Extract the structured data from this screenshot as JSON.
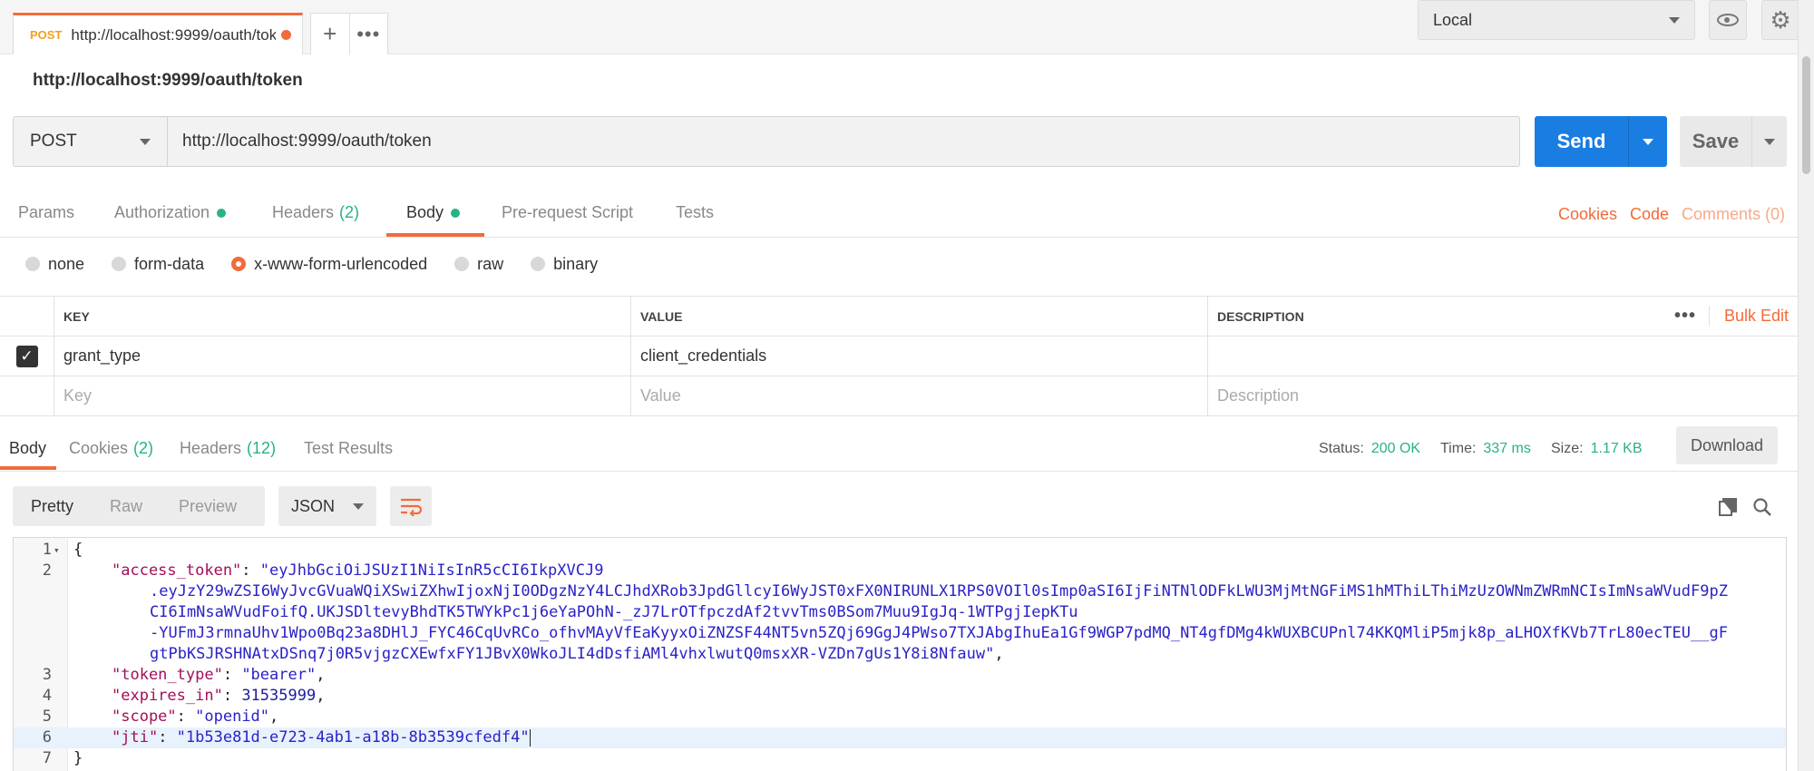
{
  "request_tab": {
    "method": "POST",
    "title": "http://localhost:9999/oauth/tok"
  },
  "tab_actions": {
    "new_tab": "+",
    "more": "•••"
  },
  "environment": {
    "selected": "Local"
  },
  "request": {
    "name": "http://localhost:9999/oauth/token",
    "method": "POST",
    "url": "http://localhost:9999/oauth/token",
    "send_label": "Send",
    "save_label": "Save"
  },
  "request_tabs": {
    "params": "Params",
    "authorization": "Authorization",
    "headers": "Headers",
    "headers_count": "(2)",
    "body": "Body",
    "prerequest": "Pre-request Script",
    "tests": "Tests",
    "cookies": "Cookies",
    "code": "Code",
    "comments": "Comments (0)"
  },
  "body_modes": {
    "none": "none",
    "form_data": "form-data",
    "urlencoded": "x-www-form-urlencoded",
    "raw": "raw",
    "binary": "binary",
    "selected": "x-www-form-urlencoded"
  },
  "params_table": {
    "headers": {
      "key": "KEY",
      "value": "VALUE",
      "description": "DESCRIPTION",
      "more": "•••",
      "bulk_edit": "Bulk Edit"
    },
    "rows": [
      {
        "checked": true,
        "key": "grant_type",
        "value": "client_credentials",
        "description": ""
      }
    ],
    "placeholders": {
      "key": "Key",
      "value": "Value",
      "description": "Description"
    }
  },
  "response": {
    "tabs": {
      "body": "Body",
      "cookies": "Cookies",
      "cookies_count": "(2)",
      "headers": "Headers",
      "headers_count": "(12)",
      "test_results": "Test Results"
    },
    "status_label": "Status:",
    "status_value": "200 OK",
    "time_label": "Time:",
    "time_value": "337 ms",
    "size_label": "Size:",
    "size_value": "1.17 KB",
    "download_label": "Download",
    "views": {
      "pretty": "Pretty",
      "raw": "Raw",
      "preview": "Preview"
    },
    "format": "JSON"
  },
  "code_lines": {
    "l1_num": "1",
    "l2_num": "2",
    "l3_num": "3",
    "l4_num": "4",
    "l5_num": "5",
    "l6_num": "6",
    "l7_num": "7",
    "open_brace": "{",
    "close_brace": "}",
    "access_token_key": "\"access_token\"",
    "access_token_p1": "\"eyJhbGciOiJSUzI1NiIsInR5cCI6IkpXVCJ9",
    "access_token_p2": ".eyJzY29wZSI6WyJvcGVuaWQiXSwiZXhwIjoxNjI0ODgzNzY4LCJhdXRob3JpdGllcyI6WyJST0xFX0NIRUNLX1RPS0VOIl0sImp0aSI6IjFiNTNlODFkLWU3MjMtNGFiMS1hMThiLThiMzUzOWNmZWRmNCIsImNsaWVudF9pZ",
    "access_token_p3": "CI6ImNsaWVudFoifQ.UKJSDltevyBhdTK5TWYkPc1j6eYaPOhN-_zJ7LrOTfpczdAf2tvvTms0BSom7Muu9IgJq-1WTPgjIepKTu",
    "access_token_p4": "-YUFmJ3rmnaUhv1Wpo0Bq23a8DHlJ_FYC46CqUvRCo_ofhvMAyVfEaKyyxOiZNZSF44NT5vn5ZQj69GgJ4PWso7TXJAbgIhuEa1Gf9WGP7pdMQ_NT4gfDMg4kWUXBCUPnl74KKQMliP5mjk8p_aLHOXfKVb7TrL80ecTEU__gF",
    "access_token_p5": "gtPbKSJRSHNAtxDSnq7j0R5vjgzCXEwfxFY1JBvX0WkoJLI4dDsfiAMl4vhxlwutQ0msxXR-VZDn7gUs1Y8i8Nfauw\"",
    "token_type_key": "\"token_type\"",
    "token_type_val": "\"bearer\"",
    "expires_in_key": "\"expires_in\"",
    "expires_in_val": "31535999",
    "scope_key": "\"scope\"",
    "scope_val": "\"openid\"",
    "jti_key": "\"jti\"",
    "jti_val": "\"1b53e81d-e723-4ab1-a18b-8b3539cfedf4\""
  },
  "colors": {
    "accent": "#f26b3a",
    "send": "#1a7de2",
    "success": "#26b47f",
    "json_key": "#a1105a",
    "json_string": "#2a22c8"
  }
}
